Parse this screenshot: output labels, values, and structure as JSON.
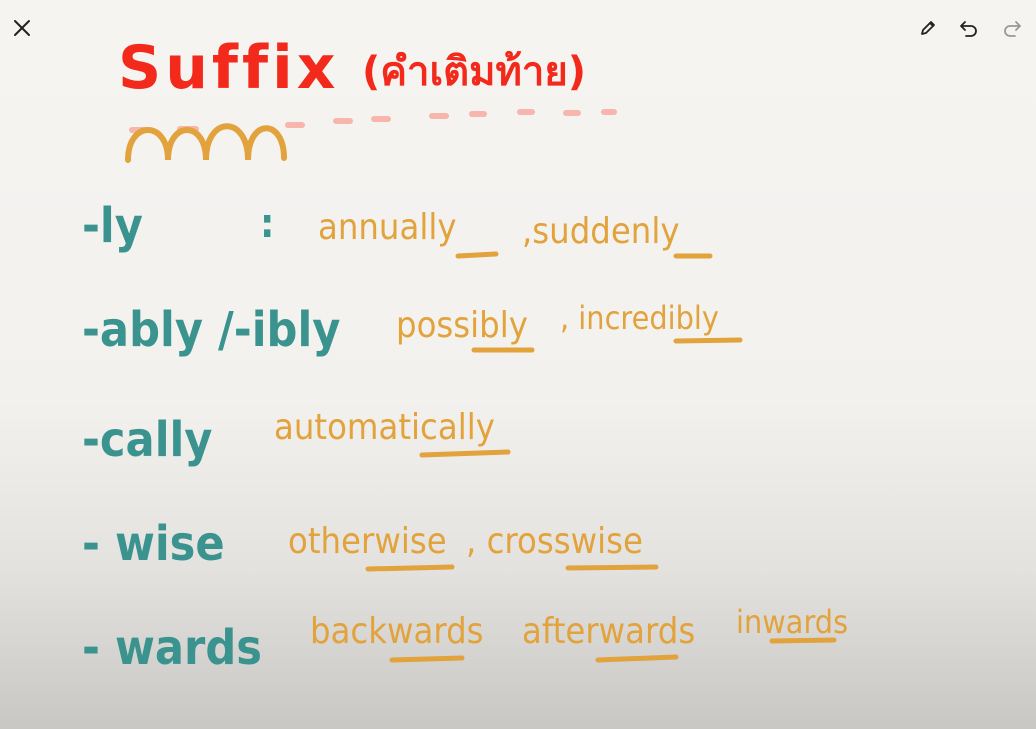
{
  "toolbar": {
    "close_icon": "close-icon",
    "pen_icon": "pencil-icon",
    "undo_icon": "undo-icon",
    "redo_icon": "redo-icon"
  },
  "board": {
    "title": "Suffix",
    "subtitle": "(คำเติมท้าย)",
    "rows": [
      {
        "suffix": "-ly",
        "separator": ":",
        "examples": [
          "annually",
          ",suddenly"
        ]
      },
      {
        "suffix": "-ably /-ibly",
        "examples": [
          "possibly",
          ", incredibly"
        ]
      },
      {
        "suffix": "-cally",
        "examples": [
          "automatically"
        ]
      },
      {
        "suffix": "- wise",
        "examples": [
          "otherwise",
          ", crosswise"
        ]
      },
      {
        "suffix": "- wards",
        "examples": [
          "backwards",
          "afterwards",
          "inwards"
        ]
      }
    ]
  },
  "colors": {
    "title": "#f2291b",
    "suffix": "#3a938e",
    "example": "#e2a23c",
    "dash": "#f7b5ad"
  }
}
